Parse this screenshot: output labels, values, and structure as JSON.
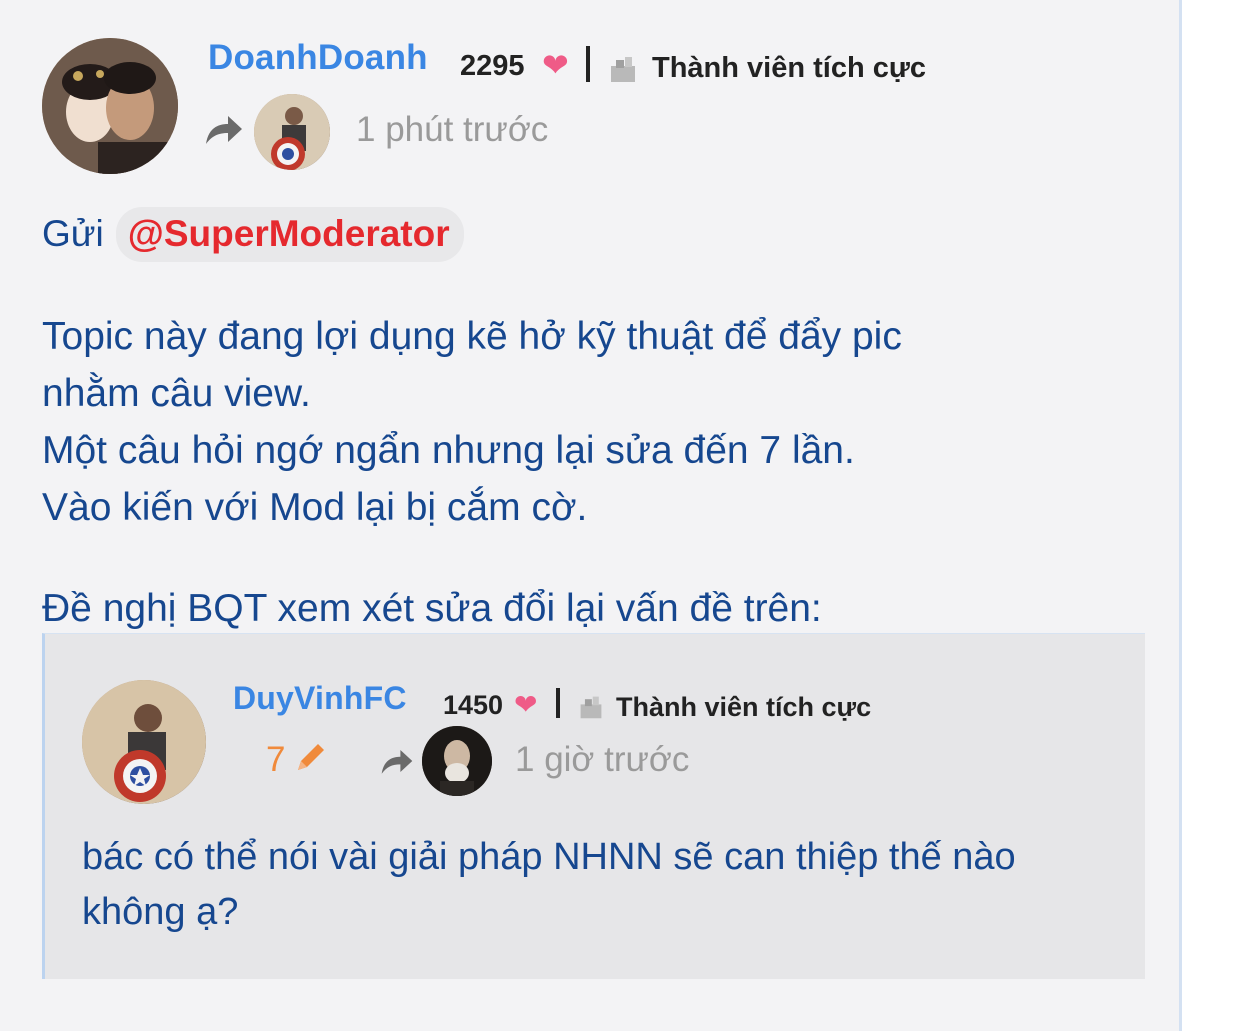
{
  "post": {
    "author": {
      "username": "DoanhDoanh",
      "score": "2295",
      "rank": "Thành viên tích cực"
    },
    "time": "1 phút trước",
    "to_label": "Gửi",
    "mention": "@SuperModerator",
    "body_lines": [
      "Topic này đang lợi dụng kẽ hở kỹ thuật để đẩy pic",
      "nhằm câu view.",
      "Một câu hỏi ngớ ngẩn nhưng lại sửa đến 7 lần.",
      "Vào kiến với Mod lại bị cắm cờ.",
      "Đề nghị BQT xem xét sửa đổi lại vấn đề trên:"
    ]
  },
  "quote": {
    "author": {
      "username": "DuyVinhFC",
      "score": "1450",
      "rank": "Thành viên tích cực"
    },
    "edit_count": "7",
    "time": "1 giờ trước",
    "body_lines": [
      "bác có thể nói vài giải pháp NHNN sẽ can thiệp thế nào",
      "không ạ?"
    ]
  },
  "icons": {
    "heart": "heart-icon",
    "rank": "member-rank-icon",
    "share": "share-arrow-icon",
    "edit": "pencil-icon"
  },
  "colors": {
    "username": "#3a86e3",
    "mention": "#e5292e",
    "body_text": "#16478f",
    "heart": "#ef5b87",
    "edit": "#f08a3b",
    "muted": "#9a9a9a",
    "quote_bg": "#e6e6e8",
    "page_bg": "#f3f3f5"
  }
}
